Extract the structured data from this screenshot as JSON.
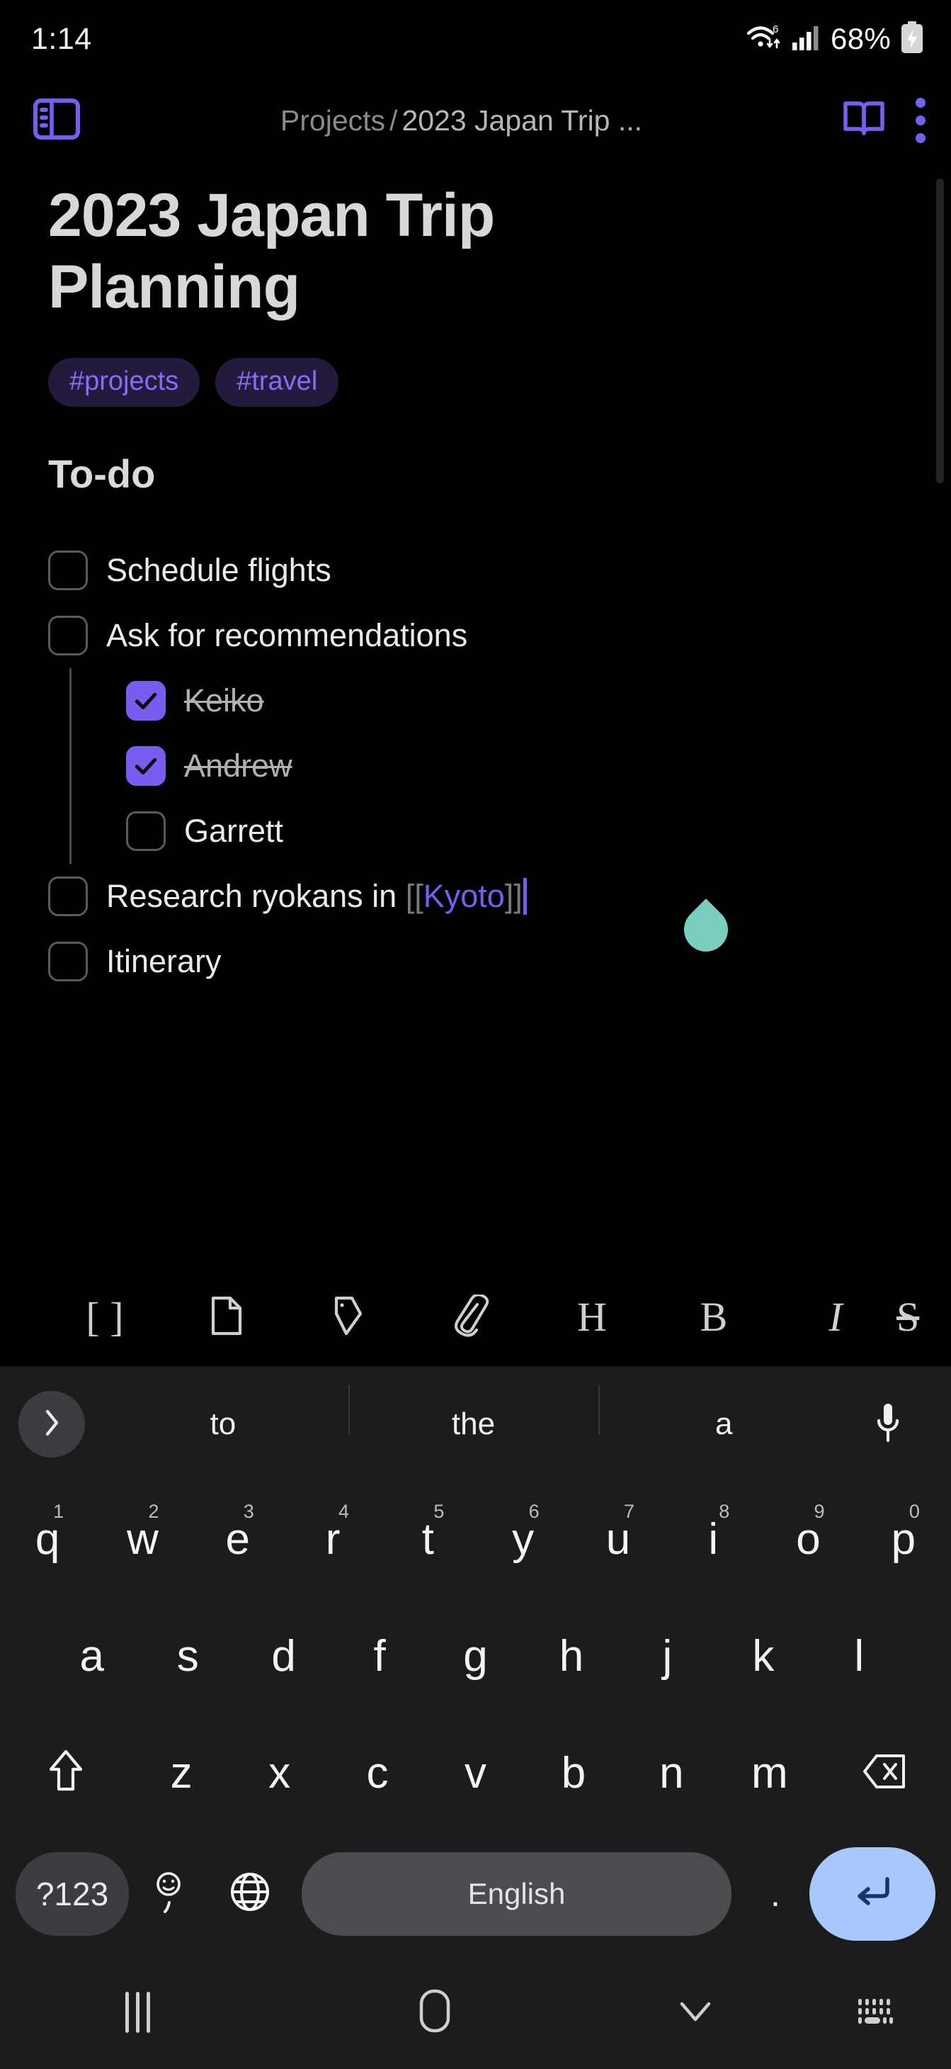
{
  "status_bar": {
    "time": "1:14",
    "battery_percent": "68%",
    "wifi_icon": "wifi-6-icon",
    "signal_icon": "cellular-signal-icon",
    "battery_icon": "battery-charging-icon"
  },
  "app_bar": {
    "sidebar_toggle_icon": "sidebar-panel-icon",
    "breadcrumb_root": "Projects",
    "breadcrumb_separator": "/",
    "breadcrumb_current": "2023 Japan Trip ...",
    "read_mode_icon": "open-book-icon",
    "overflow_icon": "kebab-menu-icon"
  },
  "note": {
    "title": "2023 Japan Trip Planning",
    "tags": [
      "#projects",
      "#travel"
    ],
    "section_heading": "To-do",
    "todos": [
      {
        "label": "Schedule flights",
        "checked": false,
        "level": 0
      },
      {
        "label": "Ask for recommendations",
        "checked": false,
        "level": 0
      },
      {
        "label": "Keiko",
        "checked": true,
        "level": 1
      },
      {
        "label": "Andrew",
        "checked": true,
        "level": 1
      },
      {
        "label": "Garrett",
        "checked": false,
        "level": 1
      }
    ],
    "research_item": {
      "checked": false,
      "prefix": "Research ryokans in ",
      "link_open": "[[",
      "link_text": "Kyoto",
      "link_close": "]]"
    },
    "itinerary_item": {
      "label": "Itinerary",
      "checked": false
    }
  },
  "format_toolbar": [
    {
      "name": "wikilink-brackets-icon",
      "glyph": "[ ]"
    },
    {
      "name": "note-document-icon",
      "glyph": ""
    },
    {
      "name": "tag-icon",
      "glyph": ""
    },
    {
      "name": "attachment-paperclip-icon",
      "glyph": ""
    },
    {
      "name": "heading-icon",
      "glyph": "H"
    },
    {
      "name": "bold-icon",
      "glyph": "B"
    },
    {
      "name": "italic-icon",
      "glyph": "I"
    },
    {
      "name": "strikethrough-icon",
      "glyph": "S"
    }
  ],
  "keyboard": {
    "expand_icon": "chevron-right-icon",
    "suggestions": [
      "to",
      "the",
      "a"
    ],
    "mic_icon": "microphone-icon",
    "row1": [
      {
        "letter": "q",
        "num": "1"
      },
      {
        "letter": "w",
        "num": "2"
      },
      {
        "letter": "e",
        "num": "3"
      },
      {
        "letter": "r",
        "num": "4"
      },
      {
        "letter": "t",
        "num": "5"
      },
      {
        "letter": "y",
        "num": "6"
      },
      {
        "letter": "u",
        "num": "7"
      },
      {
        "letter": "i",
        "num": "8"
      },
      {
        "letter": "o",
        "num": "9"
      },
      {
        "letter": "p",
        "num": "0"
      }
    ],
    "row2": [
      "a",
      "s",
      "d",
      "f",
      "g",
      "h",
      "j",
      "k",
      "l"
    ],
    "row3": [
      "z",
      "x",
      "c",
      "v",
      "b",
      "n",
      "m"
    ],
    "shift_icon": "shift-arrow-icon",
    "backspace_icon": "backspace-icon",
    "symbols_key": "?123",
    "emoji_key_icon": "emoji-comma-icon",
    "globe_key_icon": "language-globe-icon",
    "space_key": "English",
    "period_key": ".",
    "enter_key_icon": "enter-return-icon",
    "accent_color": "#a8c7fa"
  },
  "nav_bar": {
    "recents_icon": "recent-apps-icon",
    "home_icon": "home-icon",
    "hide_keyboard_icon": "chevron-down-icon",
    "keyboard_switch_icon": "keyboard-switcher-icon"
  },
  "colors": {
    "background": "#000000",
    "accent_purple": "#7b5cf0",
    "tag_bg": "#231a3d",
    "selection_handle": "#79cec0",
    "keyboard_bg": "#1c1c1c",
    "enter_key": "#a8c7fa"
  }
}
